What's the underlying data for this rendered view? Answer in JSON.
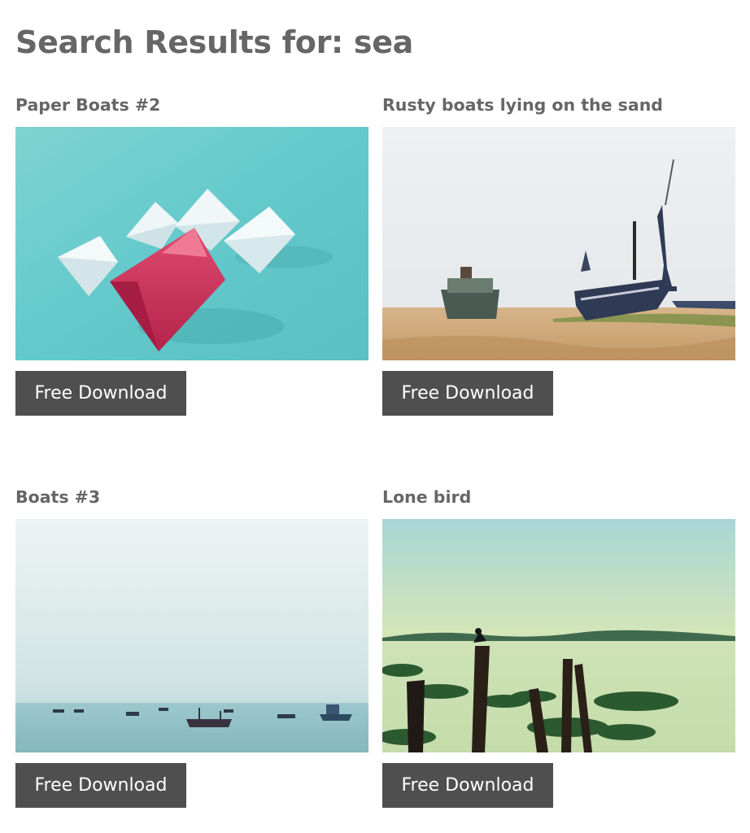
{
  "page": {
    "title": "Search Results for: sea"
  },
  "results": [
    {
      "title": "Paper Boats #2",
      "image": "paper-boats-photo",
      "button_label": "Free Download"
    },
    {
      "title": "Rusty boats lying on the sand",
      "image": "rusty-boats-photo",
      "button_label": "Free Download"
    },
    {
      "title": "Boats #3",
      "image": "boats-at-sea-photo",
      "button_label": "Free Download"
    },
    {
      "title": "Lone bird",
      "image": "lone-bird-photo",
      "button_label": "Free Download"
    }
  ],
  "colors": {
    "button_background": "#4f4f4f",
    "heading_text": "#666666"
  }
}
